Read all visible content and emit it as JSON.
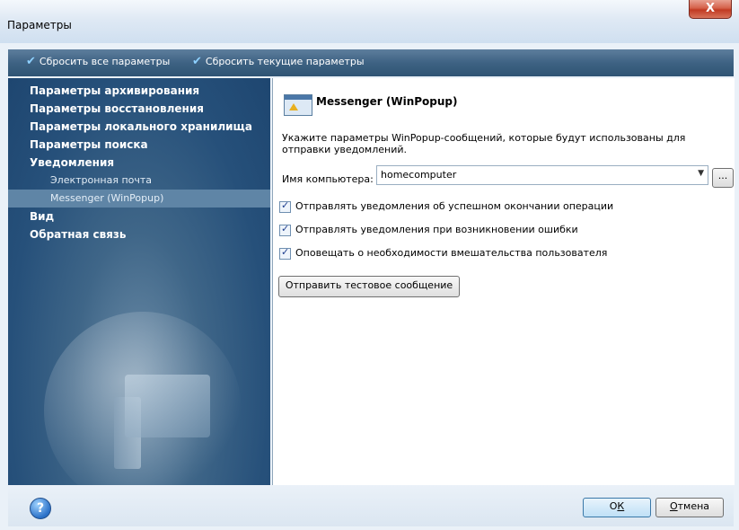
{
  "window": {
    "title": "Параметры",
    "close_label": "X"
  },
  "toolbar": {
    "reset_all": "Сбросить все параметры",
    "reset_current": "Сбросить текущие параметры"
  },
  "nav": {
    "items": [
      {
        "label": "Параметры архивирования"
      },
      {
        "label": "Параметры восстановления"
      },
      {
        "label": "Параметры локального хранилища"
      },
      {
        "label": "Параметры поиска"
      },
      {
        "label": "Уведомления"
      },
      {
        "label": "Электронная почта"
      },
      {
        "label": "Messenger (WinPopup)"
      },
      {
        "label": "Вид"
      },
      {
        "label": "Обратная связь"
      }
    ]
  },
  "content": {
    "header": "Messenger (WinPopup)",
    "description": "Укажите параметры WinPopup-сообщений, которые будут использованы для отправки уведомлений.",
    "computer_label": "Имя компьютера:",
    "computer_value": "homecomputer",
    "browse_label": "...",
    "options": [
      {
        "label": "Отправлять уведомления об успешном окончании операции",
        "checked": true
      },
      {
        "label": "Отправлять уведомления при возникновении ошибки",
        "checked": true
      },
      {
        "label": "Оповещать о необходимости вмешательства пользователя",
        "checked": true
      }
    ],
    "test_button": "Отправить тестовое сообщение"
  },
  "footer": {
    "help_symbol": "?",
    "ok_pre": "О",
    "ok_u": "К",
    "cancel_u": "О",
    "cancel_post": "тмена"
  }
}
